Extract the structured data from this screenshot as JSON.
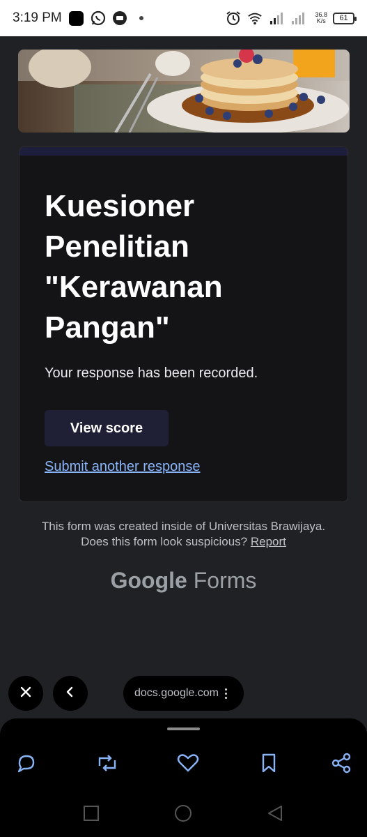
{
  "status_bar": {
    "time": "3:19 PM",
    "net_speed_value": "36.8",
    "net_speed_unit": "K/s",
    "battery": "61",
    "icons": [
      "app-icon",
      "whatsapp-icon",
      "chat-icon",
      "dot-icon",
      "alarm-icon",
      "wifi-icon",
      "signal-icon",
      "signal-icon-2",
      "battery-icon"
    ]
  },
  "form": {
    "header_image": "pancakes-photo",
    "title": "Kuesioner Penelitian \"Kerawanan Pangan\"",
    "message": "Your response has been recorded.",
    "view_score_label": "View score",
    "submit_another_label": "Submit another response",
    "accent_color": "#1c1e3c",
    "link_color": "#8ab4f8"
  },
  "footer": {
    "created_inside": "This form was created inside of Universitas Brawijaya.",
    "suspicious_prefix": "Does this form look suspicious?",
    "report_label": "Report",
    "brand_google": "Google",
    "brand_forms": "Forms"
  },
  "browser_bar": {
    "url": "docs.google.com",
    "icons": [
      "close-icon",
      "back-icon",
      "more-vert-icon"
    ]
  },
  "bottom_actions": {
    "icons": [
      "comment-icon",
      "retweet-icon",
      "like-icon",
      "bookmark-icon",
      "share-icon"
    ]
  },
  "system_nav": {
    "icons": [
      "recents-icon",
      "home-icon",
      "back-triangle-icon"
    ]
  }
}
